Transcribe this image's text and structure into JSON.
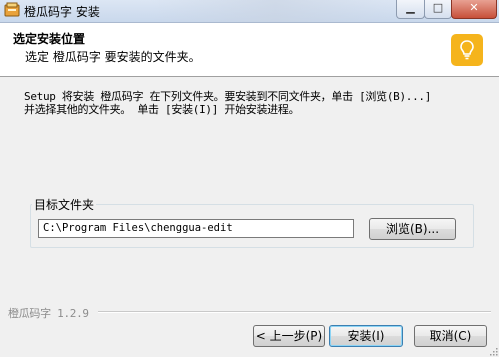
{
  "window": {
    "title": "橙瓜码字 安装",
    "min_icon": "minimize-icon",
    "max_icon": "maximize-icon",
    "close_icon": "close-icon"
  },
  "header": {
    "title": "选定安装位置",
    "subtitle": "选定 橙瓜码字 要安装的文件夹。",
    "icon": "lightbulb-icon",
    "icon_color": "#f5b41c"
  },
  "intro": {
    "line1": "Setup 将安装 橙瓜码字 在下列文件夹。要安装到不同文件夹，单击 [浏览(B)...]",
    "line2": "并选择其他的文件夹。 单击 [安装(I)] 开始安装进程。"
  },
  "destination": {
    "legend": "目标文件夹",
    "path": "C:\\Program Files\\chenggua-edit",
    "browse_label": "浏览(B)..."
  },
  "footer": {
    "version": "橙瓜码字 1.2.9",
    "back_label": "< 上一步(P)",
    "install_label": "安装(I)",
    "cancel_label": "取消(C)"
  }
}
